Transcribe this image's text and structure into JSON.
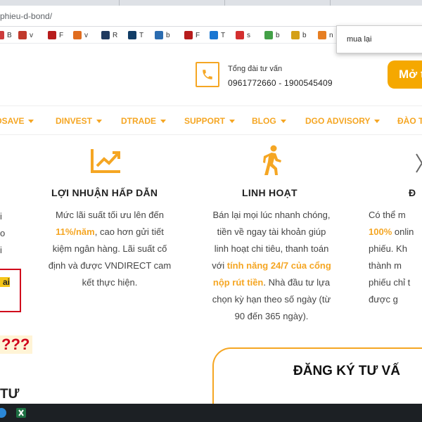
{
  "browser": {
    "url_fragment": "phieu-d-bond/",
    "bookmarks": [
      {
        "letter": "B",
        "color": "#cc3b3b"
      },
      {
        "letter": "v",
        "color": "#c0392b"
      },
      {
        "letter": "F",
        "color": "#b71c1c"
      },
      {
        "letter": "v",
        "color": "#e06c1f"
      },
      {
        "letter": "R",
        "color": "#1f3a5f"
      },
      {
        "letter": "T",
        "color": "#123d66"
      },
      {
        "letter": "b",
        "color": "#2b6cb0"
      },
      {
        "letter": "F",
        "color": "#b71c1c"
      },
      {
        "letter": "T",
        "color": "#1976d2"
      },
      {
        "letter": "s",
        "color": "#d32f2f"
      },
      {
        "letter": "b",
        "color": "#43a047"
      },
      {
        "letter": "b",
        "color": "#d4a017"
      },
      {
        "letter": "n",
        "color": "#e67e22"
      },
      {
        "letter": "F",
        "color": "#c62828"
      }
    ],
    "find_query": "mua lại"
  },
  "header": {
    "hotline_label": "Tổng đài tư vấn",
    "hotline_numbers": "0961772660 - 1900545409",
    "open_account_button": "Mở t"
  },
  "nav": {
    "items": [
      "DSAVE",
      "DINVEST",
      "DTRADE",
      "SUPPORT",
      "BLOG",
      "DGO ADVISORY",
      "ĐÀO T"
    ]
  },
  "features": [
    {
      "icon": "trending-up-icon",
      "title": "LỢI NHUẬN HẤP DẪN",
      "lines": [
        [
          {
            "t": "Mức lãi suất tối ưu lên đến",
            "h": false
          }
        ],
        [
          {
            "t": "11%/năm",
            "h": true
          },
          {
            "t": ", cao hơn gửi tiết",
            "h": false
          }
        ],
        [
          {
            "t": "kiệm ngân hàng. Lãi suất cố",
            "h": false
          }
        ],
        [
          {
            "t": "định và được VNDIRECT cam",
            "h": false
          }
        ],
        [
          {
            "t": "kết thực hiện.",
            "h": false
          }
        ]
      ]
    },
    {
      "icon": "walking-person-icon",
      "title": "LINH HOẠT",
      "lines": [
        [
          {
            "t": "Bán lại mọi lúc nhanh chóng,",
            "h": false
          }
        ],
        [
          {
            "t": "tiền về ngay tài khoản giúp",
            "h": false
          }
        ],
        [
          {
            "t": "linh hoạt chi tiêu, thanh toán",
            "h": false
          }
        ],
        [
          {
            "t": "với ",
            "h": false
          },
          {
            "t": "tính năng 24/7 của cổng",
            "h": true
          }
        ],
        [
          {
            "t": "nộp rút tiền",
            "h": true
          },
          {
            "t": ". Nhà đầu tư lựa",
            "h": false
          }
        ],
        [
          {
            "t": "chọn kỳ hạn theo số ngày (từ",
            "h": false
          }
        ],
        [
          {
            "t": "90 đến 365 ngày).",
            "h": false
          }
        ]
      ]
    },
    {
      "icon": "partial-icon",
      "title": "Đ",
      "lines": [
        [
          {
            "t": "Có thể m",
            "h": false
          }
        ],
        [
          {
            "t": "100%",
            "h": true
          },
          {
            "t": " onlin",
            "h": false
          }
        ],
        [
          {
            "t": "phiếu. Kh",
            "h": false
          }
        ],
        [
          {
            "t": "thành m",
            "h": false
          }
        ],
        [
          {
            "t": "phiếu chỉ t",
            "h": false
          }
        ],
        [
          {
            "t": "được g",
            "h": false
          }
        ]
      ]
    }
  ],
  "left_fragments": [
    "i",
    "o",
    "i",
    "ai",
    "???",
    "TƯ"
  ],
  "register": {
    "title": "ĐĂNG KÝ TƯ VẤ"
  },
  "colors": {
    "accent": "#f5a623",
    "button": "#f5a800",
    "alert": "#d0021b"
  }
}
